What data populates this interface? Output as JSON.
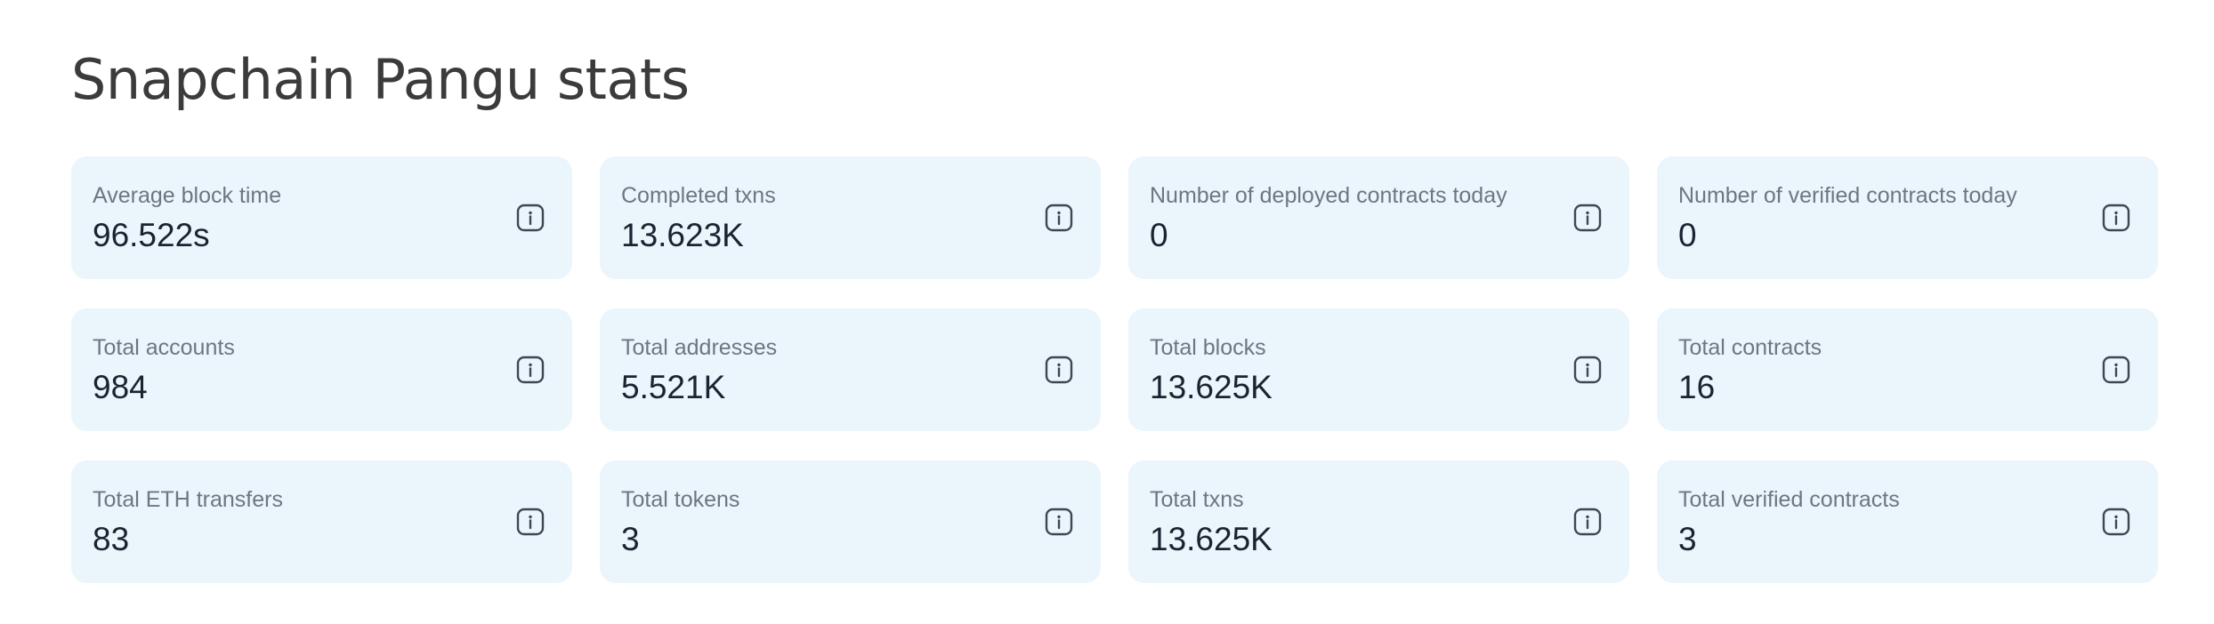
{
  "page": {
    "title": "Snapchain Pangu stats"
  },
  "stats": [
    {
      "label": "Average block time",
      "value": "96.522s",
      "icon": "info-icon"
    },
    {
      "label": "Completed txns",
      "value": "13.623K",
      "icon": "info-icon"
    },
    {
      "label": "Number of deployed contracts today",
      "value": "0",
      "icon": "info-icon"
    },
    {
      "label": "Number of verified contracts today",
      "value": "0",
      "icon": "info-icon"
    },
    {
      "label": "Total accounts",
      "value": "984",
      "icon": "info-icon"
    },
    {
      "label": "Total addresses",
      "value": "5.521K",
      "icon": "info-icon"
    },
    {
      "label": "Total blocks",
      "value": "13.625K",
      "icon": "info-icon"
    },
    {
      "label": "Total contracts",
      "value": "16",
      "icon": "info-icon"
    },
    {
      "label": "Total ETH transfers",
      "value": "83",
      "icon": "info-icon"
    },
    {
      "label": "Total tokens",
      "value": "3",
      "icon": "info-icon"
    },
    {
      "label": "Total txns",
      "value": "13.625K",
      "icon": "info-icon"
    },
    {
      "label": "Total verified contracts",
      "value": "3",
      "icon": "info-icon"
    }
  ],
  "colors": {
    "card_background": "#eaf5fc",
    "label_text": "#6e7780",
    "value_text": "#1b2331",
    "title_text": "#3b3b3b",
    "icon_stroke": "#3f4750"
  }
}
